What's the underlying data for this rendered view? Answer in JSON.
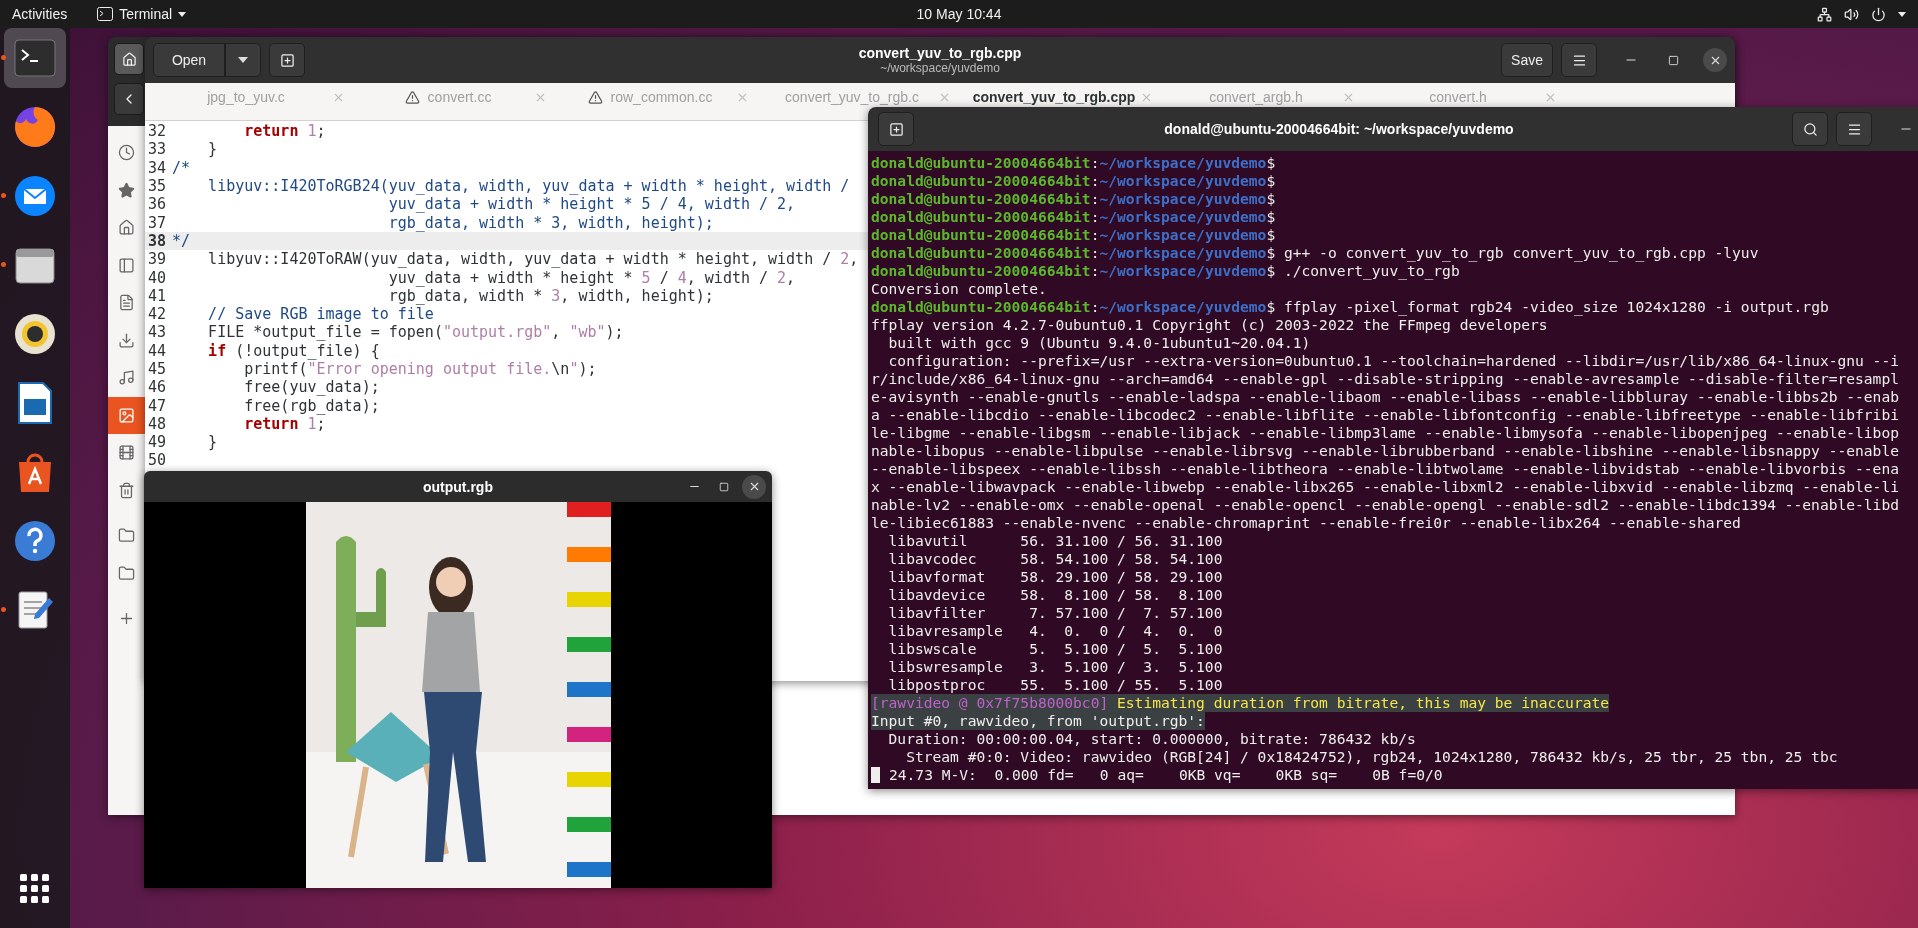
{
  "top_bar": {
    "activities": "Activities",
    "app_menu": "Terminal",
    "clock": "10 May  10:44"
  },
  "dock": {
    "items": [
      {
        "kind": "terminal",
        "selected": true,
        "running": true
      },
      {
        "kind": "browser",
        "selected": false,
        "running": false
      },
      {
        "kind": "mail",
        "selected": false,
        "running": true
      },
      {
        "kind": "files",
        "selected": false,
        "running": true
      },
      {
        "kind": "music",
        "selected": false,
        "running": false
      },
      {
        "kind": "writer",
        "selected": false,
        "running": false
      },
      {
        "kind": "store",
        "selected": false,
        "running": false
      },
      {
        "kind": "help",
        "selected": false,
        "running": false
      },
      {
        "kind": "editor",
        "selected": false,
        "running": true
      }
    ]
  },
  "files_window": {
    "sidebar": [
      {
        "kind": "recent",
        "selected": false
      },
      {
        "kind": "starred",
        "selected": false
      },
      {
        "kind": "home",
        "selected": false
      },
      {
        "kind": "desktop",
        "selected": false
      },
      {
        "kind": "documents",
        "selected": false
      },
      {
        "kind": "downloads",
        "selected": false
      },
      {
        "kind": "music",
        "selected": false
      },
      {
        "kind": "pictures",
        "selected": true
      },
      {
        "kind": "videos",
        "selected": false
      },
      {
        "kind": "trash",
        "selected": false
      },
      {
        "kind": "folder",
        "selected": false
      },
      {
        "kind": "folder",
        "selected": false
      },
      {
        "kind": "other",
        "selected": false
      }
    ]
  },
  "editor_window": {
    "open_label": "Open",
    "title": "convert_yuv_to_rgb.cpp",
    "subtitle": "~/workspace/yuvdemo",
    "save_label": "Save",
    "tabs": [
      {
        "label": "jpg_to_yuv.c",
        "selected": false,
        "warning": false
      },
      {
        "label": "convert.cc",
        "selected": false,
        "warning": true
      },
      {
        "label": "row_common.cc",
        "selected": false,
        "warning": true
      },
      {
        "label": "convert_yuv_to_rgb.c",
        "selected": false,
        "warning": false
      },
      {
        "label": "convert_yuv_to_rgb.cpp",
        "selected": true,
        "warning": false
      },
      {
        "label": "convert_argb.h",
        "selected": false,
        "warning": false
      },
      {
        "label": "convert.h",
        "selected": false,
        "warning": false
      }
    ],
    "lines": [
      {
        "number": "32",
        "current": false,
        "segments": [
          {
            "kind": "keyword",
            "text": "        return"
          },
          {
            "kind": "number",
            "text": " 1"
          },
          {
            "kind": "plain",
            "text": ";"
          }
        ]
      },
      {
        "number": "33",
        "current": false,
        "segments": [
          {
            "kind": "plain",
            "text": "    }"
          }
        ]
      },
      {
        "number": "34",
        "current": false,
        "segments": [
          {
            "kind": "comment",
            "text": "/*"
          }
        ]
      },
      {
        "number": "35",
        "current": false,
        "segments": [
          {
            "kind": "comment",
            "text": "    libyuv::I420ToRGB24(yuv_data, width, yuv_data + width * height, width /"
          }
        ]
      },
      {
        "number": "36",
        "current": false,
        "segments": [
          {
            "kind": "comment",
            "text": "                        yuv_data + width * height * 5 / 4, width / 2,"
          }
        ]
      },
      {
        "number": "37",
        "current": false,
        "segments": [
          {
            "kind": "comment",
            "text": "                        rgb_data, width * 3, width, height);"
          }
        ]
      },
      {
        "number": "38",
        "current": true,
        "segments": [
          {
            "kind": "comment",
            "text": "*/"
          }
        ]
      },
      {
        "number": "39",
        "current": false,
        "segments": [
          {
            "kind": "plain",
            "text": "    libyuv::I420ToRAW(yuv_data, width, yuv_data + width * height, width / "
          },
          {
            "kind": "number",
            "text": "2"
          },
          {
            "kind": "plain",
            "text": ","
          }
        ]
      },
      {
        "number": "40",
        "current": false,
        "segments": [
          {
            "kind": "plain",
            "text": "                        yuv_data + width * height * "
          },
          {
            "kind": "number",
            "text": "5"
          },
          {
            "kind": "plain",
            "text": " / "
          },
          {
            "kind": "number",
            "text": "4"
          },
          {
            "kind": "plain",
            "text": ", width / "
          },
          {
            "kind": "number",
            "text": "2"
          },
          {
            "kind": "plain",
            "text": ","
          }
        ]
      },
      {
        "number": "41",
        "current": false,
        "segments": [
          {
            "kind": "plain",
            "text": "                        rgb_data, width * "
          },
          {
            "kind": "number",
            "text": "3"
          },
          {
            "kind": "plain",
            "text": ", width, height);"
          }
        ]
      },
      {
        "number": "42",
        "current": false,
        "segments": [
          {
            "kind": "comment",
            "text": "    // Save RGB image to file"
          }
        ]
      },
      {
        "number": "43",
        "current": false,
        "segments": [
          {
            "kind": "plain",
            "text": "    FILE *output_file = fopen("
          },
          {
            "kind": "string",
            "text": "\"output.rgb\""
          },
          {
            "kind": "plain",
            "text": ", "
          },
          {
            "kind": "string",
            "text": "\"wb\""
          },
          {
            "kind": "plain",
            "text": ");"
          }
        ]
      },
      {
        "number": "44",
        "current": false,
        "segments": [
          {
            "kind": "keyword",
            "text": "    if"
          },
          {
            "kind": "plain",
            "text": " (!output_file) {"
          }
        ]
      },
      {
        "number": "45",
        "current": false,
        "segments": [
          {
            "kind": "plain",
            "text": "        printf("
          },
          {
            "kind": "string",
            "text": "\"Error opening output file."
          },
          {
            "kind": "escape",
            "text": "\\n"
          },
          {
            "kind": "string",
            "text": "\""
          },
          {
            "kind": "plain",
            "text": ");"
          }
        ]
      },
      {
        "number": "46",
        "current": false,
        "segments": [
          {
            "kind": "plain",
            "text": "        free(yuv_data);"
          }
        ]
      },
      {
        "number": "47",
        "current": false,
        "segments": [
          {
            "kind": "plain",
            "text": "        free(rgb_data);"
          }
        ]
      },
      {
        "number": "48",
        "current": false,
        "segments": [
          {
            "kind": "keyword",
            "text": "        return"
          },
          {
            "kind": "number",
            "text": " 1"
          },
          {
            "kind": "plain",
            "text": ";"
          }
        ]
      },
      {
        "number": "49",
        "current": false,
        "segments": [
          {
            "kind": "plain",
            "text": "    }"
          }
        ]
      },
      {
        "number": "50",
        "current": false
      }
    ]
  },
  "player_window": {
    "title": "output.rgb"
  },
  "terminal_window": {
    "title": "donald@ubuntu-20004664bit: ~/workspace/yuvdemo",
    "lines": [
      {
        "highlighted": false,
        "segments": [
          {
            "kind": "user",
            "text": "donald@ubuntu-20004664bit"
          },
          {
            "kind": "plain",
            "text": ":"
          },
          {
            "kind": "path",
            "text": "~/workspace/yuvdemo"
          },
          {
            "kind": "plain",
            "text": "$"
          }
        ]
      },
      {
        "highlighted": false,
        "segments": [
          {
            "kind": "user",
            "text": "donald@ubuntu-20004664bit"
          },
          {
            "kind": "plain",
            "text": ":"
          },
          {
            "kind": "path",
            "text": "~/workspace/yuvdemo"
          },
          {
            "kind": "plain",
            "text": "$"
          }
        ]
      },
      {
        "highlighted": false,
        "segments": [
          {
            "kind": "user",
            "text": "donald@ubuntu-20004664bit"
          },
          {
            "kind": "plain",
            "text": ":"
          },
          {
            "kind": "path",
            "text": "~/workspace/yuvdemo"
          },
          {
            "kind": "plain",
            "text": "$"
          }
        ]
      },
      {
        "highlighted": false,
        "segments": [
          {
            "kind": "user",
            "text": "donald@ubuntu-20004664bit"
          },
          {
            "kind": "plain",
            "text": ":"
          },
          {
            "kind": "path",
            "text": "~/workspace/yuvdemo"
          },
          {
            "kind": "plain",
            "text": "$"
          }
        ]
      },
      {
        "highlighted": false,
        "segments": [
          {
            "kind": "user",
            "text": "donald@ubuntu-20004664bit"
          },
          {
            "kind": "plain",
            "text": ":"
          },
          {
            "kind": "path",
            "text": "~/workspace/yuvdemo"
          },
          {
            "kind": "plain",
            "text": "$"
          }
        ]
      },
      {
        "highlighted": false,
        "segments": [
          {
            "kind": "user",
            "text": "donald@ubuntu-20004664bit"
          },
          {
            "kind": "plain",
            "text": ":"
          },
          {
            "kind": "path",
            "text": "~/workspace/yuvdemo"
          },
          {
            "kind": "plain",
            "text": "$ g++ -o convert_yuv_to_rgb convert_yuv_to_rgb.cpp -lyuv"
          }
        ]
      },
      {
        "highlighted": false,
        "segments": [
          {
            "kind": "user",
            "text": "donald@ubuntu-20004664bit"
          },
          {
            "kind": "plain",
            "text": ":"
          },
          {
            "kind": "path",
            "text": "~/workspace/yuvdemo"
          },
          {
            "kind": "plain",
            "text": "$ ./convert_yuv_to_rgb"
          }
        ]
      },
      {
        "highlighted": false,
        "segments": [
          {
            "kind": "plain",
            "text": "Conversion complete."
          }
        ]
      },
      {
        "highlighted": false,
        "segments": [
          {
            "kind": "user",
            "text": "donald@ubuntu-20004664bit"
          },
          {
            "kind": "plain",
            "text": ":"
          },
          {
            "kind": "path",
            "text": "~/workspace/yuvdemo"
          },
          {
            "kind": "plain",
            "text": "$ ffplay -pixel_format rgb24 -video_size 1024x1280 -i output.rgb"
          }
        ]
      },
      {
        "highlighted": false,
        "segments": [
          {
            "kind": "plain",
            "text": "ffplay version 4.2.7-0ubuntu0.1 Copyright (c) 2003-2022 the FFmpeg developers"
          }
        ]
      },
      {
        "highlighted": false,
        "segments": [
          {
            "kind": "plain",
            "text": "  built with gcc 9 (Ubuntu 9.4.0-1ubuntu1~20.04.1)"
          }
        ]
      },
      {
        "highlighted": false,
        "segments": [
          {
            "kind": "plain",
            "text": "  configuration: --prefix=/usr --extra-version=0ubuntu0.1 --toolchain=hardened --libdir=/usr/lib/x86_64-linux-gnu --i"
          }
        ]
      },
      {
        "highlighted": false,
        "segments": [
          {
            "kind": "plain",
            "text": "r/include/x86_64-linux-gnu --arch=amd64 --enable-gpl --disable-stripping --enable-avresample --disable-filter=resampl"
          }
        ]
      },
      {
        "highlighted": false,
        "segments": [
          {
            "kind": "plain",
            "text": "e-avisynth --enable-gnutls --enable-ladspa --enable-libaom --enable-libass --enable-libbluray --enable-libbs2b --enab"
          }
        ]
      },
      {
        "highlighted": false,
        "segments": [
          {
            "kind": "plain",
            "text": "a --enable-libcdio --enable-libcodec2 --enable-libflite --enable-libfontconfig --enable-libfreetype --enable-libfribi"
          }
        ]
      },
      {
        "highlighted": false,
        "segments": [
          {
            "kind": "plain",
            "text": "le-libgme --enable-libgsm --enable-libjack --enable-libmp3lame --enable-libmysofa --enable-libopenjpeg --enable-libop"
          }
        ]
      },
      {
        "highlighted": false,
        "segments": [
          {
            "kind": "plain",
            "text": "nable-libopus --enable-libpulse --enable-librsvg --enable-librubberband --enable-libshine --enable-libsnappy --enable"
          }
        ]
      },
      {
        "highlighted": false,
        "segments": [
          {
            "kind": "plain",
            "text": "--enable-libspeex --enable-libssh --enable-libtheora --enable-libtwolame --enable-libvidstab --enable-libvorbis --ena"
          }
        ]
      },
      {
        "highlighted": false,
        "segments": [
          {
            "kind": "plain",
            "text": "x --enable-libwavpack --enable-libwebp --enable-libx265 --enable-libxml2 --enable-libxvid --enable-libzmq --enable-li"
          }
        ]
      },
      {
        "highlighted": false,
        "segments": [
          {
            "kind": "plain",
            "text": "nable-lv2 --enable-omx --enable-openal --enable-opencl --enable-opengl --enable-sdl2 --enable-libdc1394 --enable-libd"
          }
        ]
      },
      {
        "highlighted": false,
        "segments": [
          {
            "kind": "plain",
            "text": "le-libiec61883 --enable-nvenc --enable-chromaprint --enable-frei0r --enable-libx264 --enable-shared"
          }
        ]
      },
      {
        "highlighted": false,
        "segments": [
          {
            "kind": "plain",
            "text": "  libavutil      56. 31.100 / 56. 31.100"
          }
        ]
      },
      {
        "highlighted": false,
        "segments": [
          {
            "kind": "plain",
            "text": "  libavcodec     58. 54.100 / 58. 54.100"
          }
        ]
      },
      {
        "highlighted": false,
        "segments": [
          {
            "kind": "plain",
            "text": "  libavformat    58. 29.100 / 58. 29.100"
          }
        ]
      },
      {
        "highlighted": false,
        "segments": [
          {
            "kind": "plain",
            "text": "  libavdevice    58.  8.100 / 58.  8.100"
          }
        ]
      },
      {
        "highlighted": false,
        "segments": [
          {
            "kind": "plain",
            "text": "  libavfilter     7. 57.100 /  7. 57.100"
          }
        ]
      },
      {
        "highlighted": false,
        "segments": [
          {
            "kind": "plain",
            "text": "  libavresample   4.  0.  0 /  4.  0.  0"
          }
        ]
      },
      {
        "highlighted": false,
        "segments": [
          {
            "kind": "plain",
            "text": "  libswscale      5.  5.100 /  5.  5.100"
          }
        ]
      },
      {
        "highlighted": false,
        "segments": [
          {
            "kind": "plain",
            "text": "  libswresample   3.  5.100 /  3.  5.100"
          }
        ]
      },
      {
        "highlighted": false,
        "segments": [
          {
            "kind": "plain",
            "text": "  libpostproc    55.  5.100 / 55.  5.100"
          }
        ]
      },
      {
        "highlighted": true,
        "segments": [
          {
            "kind": "tag",
            "text": "[rawvideo @ 0x7f75b8000bc0]"
          },
          {
            "kind": "warning",
            "text": " Estimating duration from bitrate, this may be inaccurate"
          }
        ]
      },
      {
        "highlighted": true,
        "segments": [
          {
            "kind": "plain",
            "text": "Input #0, rawvideo, from 'output.rgb':"
          }
        ]
      },
      {
        "highlighted": false,
        "segments": [
          {
            "kind": "plain",
            "text": "  Duration: 00:00:00.04, start: 0.000000, bitrate: 786432 kb/s"
          }
        ]
      },
      {
        "highlighted": false,
        "segments": [
          {
            "kind": "plain",
            "text": "    Stream #0:0: Video: rawvideo (RGB[24] / 0x18424752), rgb24, 1024x1280, 786432 kb/s, 25 tbr, 25 tbn, 25 tbc"
          }
        ]
      },
      {
        "highlighted": false,
        "segments": [
          {
            "kind": "cursor"
          },
          {
            "kind": "plain",
            "text": "24.73 M-V:  0.000 fd=   0 aq=    0KB vq=    0KB sq=    0B f=0/0"
          }
        ]
      }
    ]
  }
}
